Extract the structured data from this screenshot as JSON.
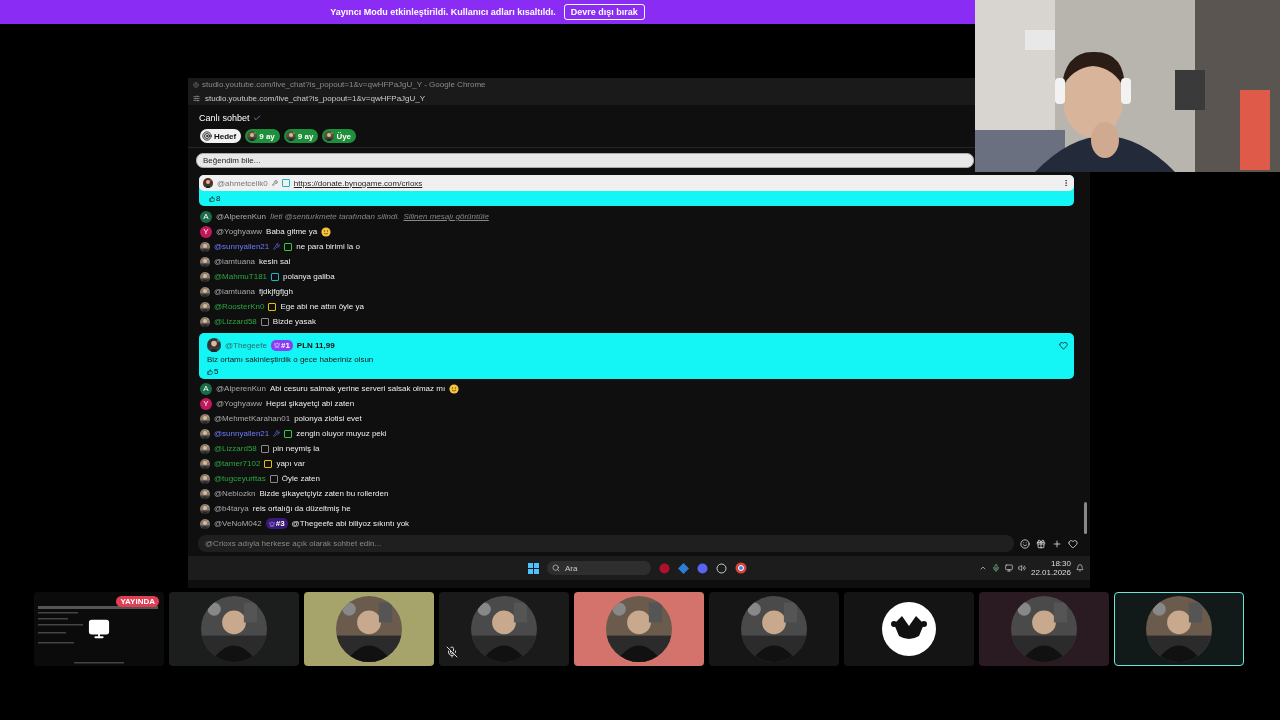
{
  "banner": {
    "text": "Yayıncı Modu etkinleştirildi. Kullanıcı adları kısaltıldı.",
    "button": "Devre dışı bırak"
  },
  "webcam": {
    "kind": "picture"
  },
  "shared_screen": {
    "window_title": "studio.youtube.com/live_chat?is_popout=1&v=qwHFPaJgU_Y - Google Chrome",
    "address": "studio.youtube.com/live_chat?is_popout=1&v=qwHFPaJgU_Y",
    "chat_title": "Canlı sohbet",
    "chips": [
      {
        "kind": "goal",
        "label": "Hedef"
      },
      {
        "kind": "member",
        "label": "9 ay"
      },
      {
        "kind": "member",
        "label": "9 ay"
      },
      {
        "kind": "member",
        "label": "Üye"
      }
    ],
    "pinned_poll": "Beğendim bile...",
    "pinned_message": {
      "author": "@ahmetcelik0",
      "link": "https://donate.bynogame.com/crioxs",
      "likes": "8"
    },
    "messages_before": [
      {
        "kind": "deleted",
        "author": "@AlperenKun",
        "moderator": false,
        "member": false,
        "avatar": {
          "kind": "letter",
          "letter": "A",
          "color": "#1b6b48"
        },
        "text": "İleti @senturkmete tarafından silindi.",
        "link": "Silinen mesajı görüntüle",
        "emoji": false
      },
      {
        "kind": "text",
        "author": "@Yoghyaww",
        "moderator": false,
        "member": false,
        "avatar": {
          "kind": "letter",
          "letter": "Y",
          "color": "#c2185b"
        },
        "text": "Baba gitme ya",
        "emoji": true
      },
      {
        "kind": "text",
        "author": "@sunnyallen21",
        "moderator": true,
        "avatar": {
          "kind": "picture"
        },
        "badges": [
          {
            "kind": "wrench"
          },
          {
            "kind": "member",
            "color": "#2ecc40"
          }
        ],
        "text": "ne para birimi la o",
        "emoji": false
      },
      {
        "kind": "text",
        "author": "@iamtuana",
        "moderator": false,
        "member": false,
        "avatar": {
          "kind": "picture"
        },
        "text": "kesin sal",
        "emoji": false
      },
      {
        "kind": "text",
        "author": "@MahmuT181",
        "moderator": false,
        "member": true,
        "avatar": {
          "kind": "picture"
        },
        "badges": [
          {
            "kind": "member",
            "color": "#19b5c8"
          }
        ],
        "text": "polanya galiba",
        "emoji": false
      },
      {
        "kind": "text",
        "author": "@iamtuana",
        "moderator": false,
        "member": false,
        "avatar": {
          "kind": "picture"
        },
        "text": "fjdkjfgfjgh",
        "emoji": false
      },
      {
        "kind": "text",
        "author": "@RoosterKn0",
        "moderator": false,
        "member": true,
        "avatar": {
          "kind": "picture"
        },
        "badges": [
          {
            "kind": "member",
            "color": "#e5c100"
          }
        ],
        "text": "Ege abi ne attın öyle ya",
        "emoji": false
      },
      {
        "kind": "text",
        "author": "@Lizzard58",
        "moderator": false,
        "member": true,
        "avatar": {
          "kind": "picture"
        },
        "badges": [
          {
            "kind": "member",
            "color": "#8a8a8a"
          }
        ],
        "text": "Bizde yasak",
        "emoji": false
      }
    ],
    "paid_message": {
      "author": "@Thegeefe",
      "rank": "#1",
      "amount": "PLN 11,99",
      "text": "Biz ortamı sakinleştirdik o gece haberiniz olsun",
      "likes": "5"
    },
    "messages_after": [
      {
        "kind": "text",
        "author": "@AlperenKun",
        "moderator": false,
        "member": false,
        "avatar": {
          "kind": "letter",
          "letter": "A",
          "color": "#1b6b48"
        },
        "text": "Abi cesuru salmak yerine serveri salsak olmaz mı",
        "emoji": true
      },
      {
        "kind": "text",
        "author": "@Yoghyaww",
        "moderator": false,
        "member": false,
        "avatar": {
          "kind": "letter",
          "letter": "Y",
          "color": "#c2185b"
        },
        "text": "Hepsi şikayetçi abi zaten",
        "emoji": false
      },
      {
        "kind": "text",
        "author": "@MehmetKarahan01",
        "moderator": false,
        "member": false,
        "avatar": {
          "kind": "picture"
        },
        "text": "polonya zlotisi evet",
        "emoji": false
      },
      {
        "kind": "text",
        "author": "@sunnyallen21",
        "moderator": true,
        "avatar": {
          "kind": "picture"
        },
        "badges": [
          {
            "kind": "wrench"
          },
          {
            "kind": "member",
            "color": "#2ecc40"
          }
        ],
        "text": "zengin oluyor muyuz peki",
        "emoji": false
      },
      {
        "kind": "text",
        "author": "@Lizzard58",
        "moderator": false,
        "member": true,
        "avatar": {
          "kind": "picture"
        },
        "badges": [
          {
            "kind": "member",
            "color": "#8a8a8a"
          }
        ],
        "text": "pin neymiş la",
        "emoji": false
      },
      {
        "kind": "text",
        "author": "@tamer7102",
        "moderator": false,
        "member": true,
        "avatar": {
          "kind": "picture"
        },
        "badges": [
          {
            "kind": "member",
            "color": "#e5c100"
          }
        ],
        "text": "yapı var",
        "emoji": false
      },
      {
        "kind": "text",
        "author": "@tugceyurttas",
        "moderator": false,
        "member": true,
        "avatar": {
          "kind": "picture"
        },
        "badges": [
          {
            "kind": "member",
            "color": "#8a8a8a"
          }
        ],
        "text": "Öyle zaten",
        "emoji": false
      },
      {
        "kind": "text",
        "author": "@Nebiozkn",
        "moderator": false,
        "member": false,
        "avatar": {
          "kind": "picture"
        },
        "text": "Bizde şikayetçiyiz zaten bu rollerden",
        "emoji": false
      },
      {
        "kind": "text",
        "author": "@b4tarya",
        "moderator": false,
        "member": false,
        "avatar": {
          "kind": "picture"
        },
        "text": "reis ortalığı da düzeltmiş he",
        "emoji": false
      },
      {
        "kind": "rank",
        "author": "@VeNoM042",
        "moderator": false,
        "member": false,
        "avatar": {
          "kind": "picture"
        },
        "rank": "#3",
        "text": "@Thegeefe abi biliyoz sıkıntı yok",
        "emoji": false
      }
    ],
    "input_placeholder": "@Crioxs adıyla herkese açık olarak sohbet edin...",
    "taskbar": {
      "search": "Ara",
      "time": "18:30",
      "date": "22.01.2026"
    }
  },
  "participants": [
    {
      "kind": "screen",
      "badge": "YAYINDA",
      "color": "#0b0b0b",
      "muted": false,
      "selected": false
    },
    {
      "kind": "avatar",
      "color": "#1c1e1d",
      "muted": false,
      "selected": false
    },
    {
      "kind": "avatar",
      "color": "#a6a46a",
      "muted": false,
      "selected": false
    },
    {
      "kind": "avatar",
      "color": "#1a1a1a",
      "muted": true,
      "selected": false
    },
    {
      "kind": "avatar",
      "color": "#d4736b",
      "muted": false,
      "selected": false
    },
    {
      "kind": "avatar",
      "color": "#161616",
      "muted": false,
      "selected": false
    },
    {
      "kind": "logo",
      "color": "#141414",
      "muted": false,
      "selected": false
    },
    {
      "kind": "avatar",
      "color": "#2a1a22",
      "muted": false,
      "selected": false
    },
    {
      "kind": "avatar",
      "color": "#111a18",
      "muted": false,
      "selected": true
    }
  ]
}
